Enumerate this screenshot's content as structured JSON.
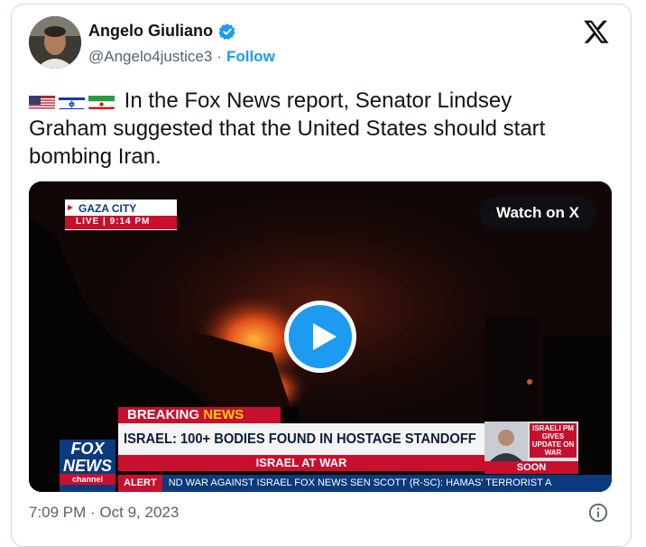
{
  "author": {
    "name": "Angelo Giuliano",
    "handle": "@Angelo4justice3",
    "separator": "·",
    "follow_label": "Follow"
  },
  "tweet": {
    "text": "In the Fox News report, Senator Lindsey Graham suggested that the United States should start bombing Iran.",
    "flags": [
      "us-flag-icon",
      "israel-flag-icon",
      "iran-flag-icon"
    ]
  },
  "video": {
    "location_label": "GAZA CITY",
    "live_label": "LIVE",
    "live_time": "9:14 PM",
    "watch_label": "Watch on X",
    "breaking_label": "BREAKING",
    "news_label": "NEWS",
    "headline": "ISRAEL: 100+ BODIES FOUND IN HOSTAGE STANDOFF",
    "subhead": "ISRAEL AT WAR",
    "alert_label": "ALERT",
    "ticker": "ND WAR AGAINST ISRAEL    FOX NEWS   SEN SCOTT (R-SC): HAMAS' TERRORIST A",
    "side_box": "ISRAELI PM GIVES UPDATE ON WAR",
    "soon_label": "SOON",
    "logo_line1": "FOX",
    "logo_line2": "NEWS",
    "logo_line3": "channel"
  },
  "meta": {
    "timestamp": "7:09 PM · Oct 9, 2023"
  },
  "colors": {
    "accent": "#1d9bf0",
    "text": "#0f1419",
    "muted": "#536471",
    "fox_red": "#c8102e",
    "fox_blue": "#0b3a7e"
  }
}
